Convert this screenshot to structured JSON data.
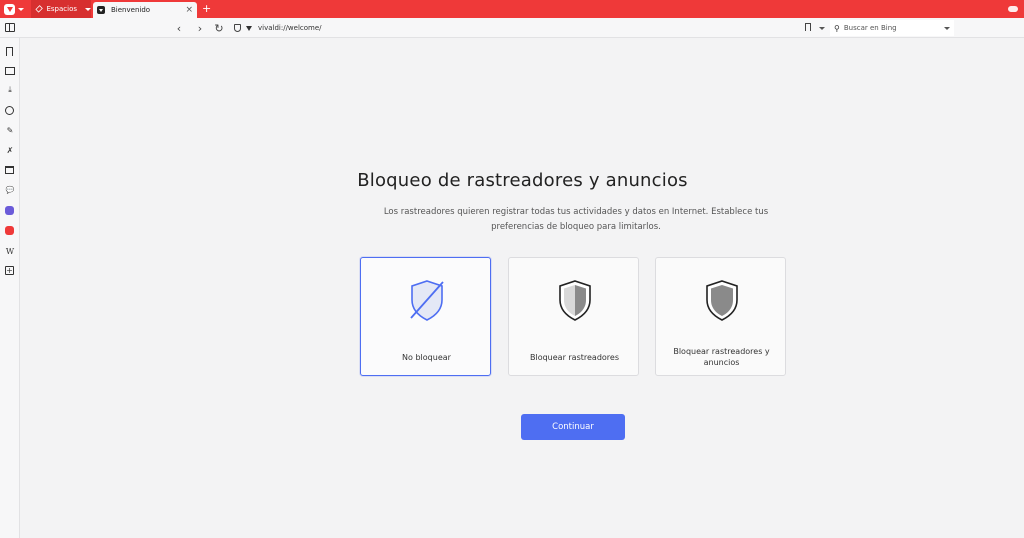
{
  "tabs": {
    "spaces_label": "Espacios",
    "active_tab_title": "Bienvenido",
    "close_glyph": "×",
    "new_tab_glyph": "+"
  },
  "address_bar": {
    "back_glyph": "‹",
    "forward_glyph": "›",
    "reload_glyph": "↻",
    "url": "vivaldi://welcome/",
    "search_placeholder": "Buscar en Bing"
  },
  "side_panel": {
    "icons": [
      "bookmarks-icon",
      "reading-list-icon",
      "downloads-icon",
      "history-icon",
      "notes-icon",
      "translate-icon",
      "window-icon",
      "chat-icon",
      "mastodon-icon",
      "vivaldi-icon",
      "wikipedia-icon",
      "add-panel-icon"
    ],
    "wiki_glyph": "W",
    "plus_glyph": "+",
    "download_glyph": "⤓",
    "notes_glyph": "✎",
    "chat_glyph": "💬",
    "translate_glyph": "✗"
  },
  "content": {
    "title": "Bloqueo de rastreadores y anuncios",
    "subtitle": "Los rastreadores quieren registrar todas tus actividades y datos en Internet. Establece tus preferencias de bloqueo para limitarlos.",
    "options": [
      {
        "label": "No bloquear",
        "selected": true
      },
      {
        "label": "Bloquear rastreadores",
        "selected": false
      },
      {
        "label": "Bloquear rastreadores y anuncios",
        "selected": false
      }
    ],
    "continue_label": "Continuar"
  },
  "colors": {
    "brand_red": "#ef3939",
    "accent_blue": "#4e6ef2"
  }
}
